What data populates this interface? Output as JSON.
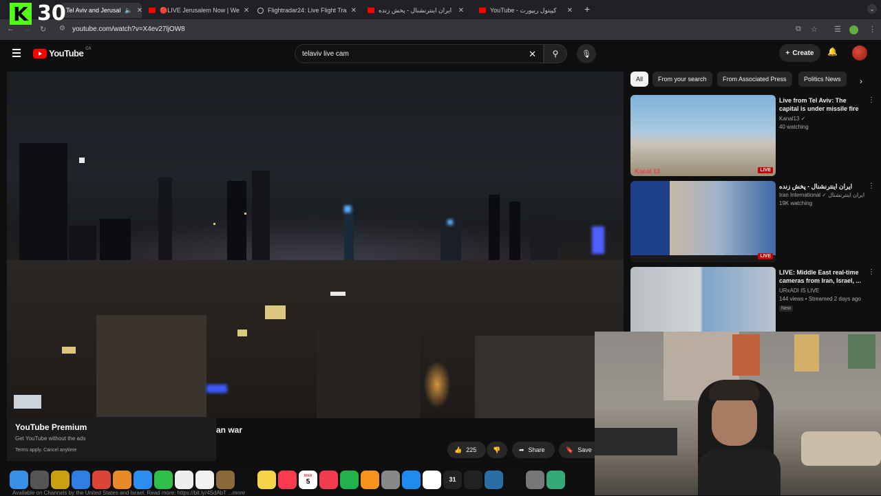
{
  "overlay": {
    "k_logo": "K",
    "counter": "30"
  },
  "tabs": [
    {
      "label": "Tel Aviv and Jerusal",
      "active": true,
      "icon": "youtube-icon"
    },
    {
      "label": "🔴LIVE Jerusalem Now | We",
      "icon": "youtube-icon"
    },
    {
      "label": "Flightradar24: Live Flight Tra",
      "icon": "globe-icon"
    },
    {
      "label": "ایران اینترنشنال - پخش زنده",
      "icon": "youtube-icon"
    },
    {
      "label": "YouTube - کپیتول ریپورت",
      "icon": "youtube-icon"
    }
  ],
  "address": {
    "url": "youtube.com/watch?v=X4ev27ljOW8"
  },
  "header": {
    "logo_text": "YouTube",
    "country": "CA",
    "search_value": "telaviv live cam",
    "create_label": "Create"
  },
  "chips": [
    "All",
    "From your search",
    "From Associated Press",
    "Politics News"
  ],
  "recommendations": [
    {
      "title": "Live from Tel Aviv: The capital is under missile fire",
      "channel": "Kanal13 ✓",
      "meta": "40 watching",
      "badge": "LIVE",
      "thumb_label": "Kanal 13",
      "new": ""
    },
    {
      "title": "ایران اینترنشنال - پخش زنده",
      "channel": "Iran International ✓ ایران اینترنشنال",
      "meta": "19K watching",
      "badge": "LIVE",
      "thumb_label": "",
      "new": ""
    },
    {
      "title": "LIVE: Middle East real-time cameras from Iran, Israel, ...",
      "channel": "URxADI IS LIVE",
      "meta": "144 views • Streamed 2 days ago",
      "badge": "",
      "thumb_label": "",
      "new": "New"
    }
  ],
  "premium": {
    "title": "YouTube Premium",
    "subtitle": "Get YouTube without the ads",
    "terms": "Terms apply. Cancel anytime"
  },
  "video": {
    "title_fragment": "an war"
  },
  "actions": {
    "likes": "225",
    "share_label": "Share",
    "save_label": "Save"
  },
  "dock_apps": [
    {
      "name": "finder",
      "color": "#3a8ee6"
    },
    {
      "name": "launchpad",
      "color": "#555"
    },
    {
      "name": "app",
      "color": "#c8a010"
    },
    {
      "name": "safari",
      "color": "#2f7de1"
    },
    {
      "name": "chrome",
      "color": "#db4437"
    },
    {
      "name": "photos",
      "color": "#e98a2a"
    },
    {
      "name": "mail",
      "color": "#2e8ef0"
    },
    {
      "name": "facetime",
      "color": "#2fbf4a"
    },
    {
      "name": "reminders",
      "color": "#eee"
    },
    {
      "name": "freeform",
      "color": "#f2f2f2"
    },
    {
      "name": "app",
      "color": "#8a6a3a"
    },
    {
      "name": "tv",
      "color": "#111"
    },
    {
      "name": "notes",
      "color": "#f7d44a"
    },
    {
      "name": "music",
      "color": "#fa3b4f"
    },
    {
      "name": "calendar",
      "color": "#fff"
    },
    {
      "name": "news",
      "color": "#f23b4e"
    },
    {
      "name": "numbers",
      "color": "#23b14d"
    },
    {
      "name": "pages",
      "color": "#f7921e"
    },
    {
      "name": "settings",
      "color": "#888"
    },
    {
      "name": "app-store",
      "color": "#1e8bf0"
    },
    {
      "name": "notion",
      "color": "#fff"
    },
    {
      "name": "calendar",
      "color": "#222"
    },
    {
      "name": "app",
      "color": "#222"
    },
    {
      "name": "app",
      "color": "#2a6ea5"
    },
    {
      "name": "unity",
      "color": "#111"
    },
    {
      "name": "app",
      "color": "#777"
    },
    {
      "name": "app",
      "color": "#3a7"
    }
  ],
  "calendar_day": "5",
  "calendar_month": "MAR",
  "calendar_31": "31",
  "bottom_text": "Available on Channels by the United States and Israel. Read more: https://bit.ly/4SdAbT ...more"
}
